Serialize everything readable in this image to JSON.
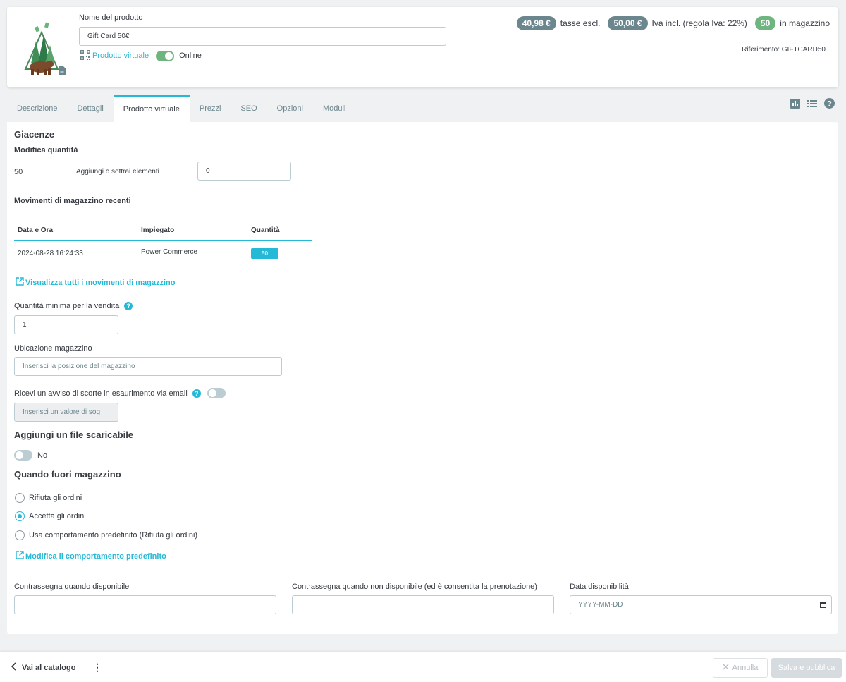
{
  "header": {
    "name_label": "Nome del prodotto",
    "name_value": "Gift Card 50€",
    "virtual_label": "Prodotto virtuale",
    "online_label": "Online",
    "price_excl": "40,98 €",
    "price_excl_label": "tasse escl.",
    "price_incl": "50,00 €",
    "price_incl_label": "Iva incl. (regola Iva: 22%)",
    "stock": "50",
    "stock_label": "in magazzino",
    "reference": "Riferimento: GIFTCARD50",
    "online_enabled": true
  },
  "tabs": [
    {
      "label": "Descrizione"
    },
    {
      "label": "Dettagli"
    },
    {
      "label": "Prodotto virtuale",
      "active": true
    },
    {
      "label": "Prezzi"
    },
    {
      "label": "SEO"
    },
    {
      "label": "Opzioni"
    },
    {
      "label": "Moduli"
    }
  ],
  "tab_icons": [
    "bar-chart-icon",
    "list-icon",
    "help-icon"
  ],
  "stock": {
    "title": "Giacenze",
    "modify_title": "Modifica quantità",
    "current_qty": "50",
    "add_label": "Aggiungi o sottrai elementi",
    "add_value": "0",
    "movements_title": "Movimenti di magazzino recenti",
    "table_headers": [
      "Data e Ora",
      "Impiegato",
      "Quantità"
    ],
    "rows": [
      {
        "date": "2024-08-28 16:24:33",
        "employee": "Power Commerce",
        "qty": "50"
      }
    ],
    "view_all_link": "Visualizza tutti i movimenti di magazzino",
    "min_qty_label": "Quantità minima per la vendita",
    "min_qty_value": "1",
    "location_label": "Ubicazione magazzino",
    "location_placeholder": "Inserisci la posizione del magazzino",
    "low_stock_label": "Ricevi un avviso di scorte in esaurimento via email",
    "low_stock_placeholder": "Inserisci un valore di sog",
    "low_stock_enabled": false
  },
  "download": {
    "title": "Aggiungi un file scaricabile",
    "toggle_label": "No",
    "enabled": false
  },
  "out_of_stock": {
    "title": "Quando fuori magazzino",
    "options": [
      {
        "label": "Rifiuta gli ordini",
        "checked": false
      },
      {
        "label": "Accetta gli ordini",
        "checked": true
      },
      {
        "label": "Usa comportamento predefinito (Rifiuta gli ordini)",
        "checked": false
      }
    ],
    "modify_link": "Modifica il comportamento predefinito"
  },
  "availability": {
    "in_stock_label": "Contrassegna quando disponibile",
    "in_stock_value": "",
    "out_stock_label": "Contrassegna quando non disponibile (ed è consentita la prenotazione)",
    "out_stock_value": "",
    "date_label": "Data disponibilità",
    "date_placeholder": "YYYY-MM-DD"
  },
  "footer": {
    "back_label": "Vai al catalogo",
    "cancel_label": "Annulla",
    "save_label": "Salva e pubblica"
  },
  "colors": {
    "accent": "#25b9d7",
    "success": "#70b580",
    "badge_gray": "#6c868e"
  }
}
